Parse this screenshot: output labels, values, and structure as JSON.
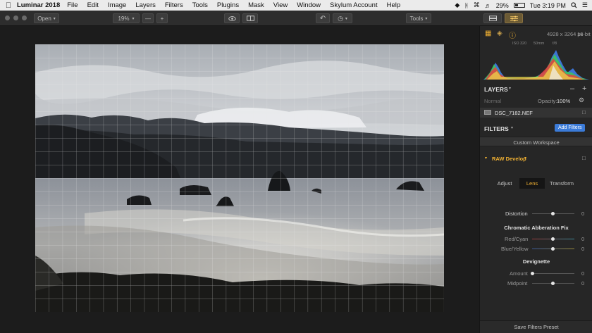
{
  "menubar": {
    "app_name": "Luminar 2018",
    "items": [
      "File",
      "Edit",
      "Image",
      "Layers",
      "Filters",
      "Tools",
      "Plugins",
      "Mask",
      "View",
      "Window",
      "Skylum Account",
      "Help"
    ],
    "battery": "29%",
    "clock": "Tue 3:19 PM"
  },
  "toolbar": {
    "open_label": "Open",
    "zoom_value": "19%",
    "zoom_minus": "—",
    "zoom_plus": "+",
    "tools_label": "Tools"
  },
  "panel": {
    "image_info": "4928 x 3264 px",
    "bit_depth": "16-bit",
    "histogram_labels": [
      "ISO 320",
      "50mm",
      "f/8"
    ],
    "layers_title": "LAYERS",
    "blend_mode": "Normal",
    "opacity_label": "Opacity:",
    "opacity_value": "100%",
    "layer_name": "DSC_7182.NEF",
    "filters_title": "FILTERS",
    "add_filters": "Add Filters",
    "workspace": "Custom Workspace",
    "raw_develop": "RAW Develop",
    "tabs": [
      "Adjust",
      "Lens",
      "Transform"
    ],
    "active_tab": "Lens",
    "distortion": {
      "label": "Distortion",
      "value": "0"
    },
    "chromatic_title": "Chromatic Abberation Fix",
    "red_cyan": {
      "label": "Red/Cyan",
      "value": "0"
    },
    "blue_yellow": {
      "label": "Blue/Yellow",
      "value": "0"
    },
    "devignette_title": "Devignette",
    "amount": {
      "label": "Amount",
      "value": "0"
    },
    "midpoint": {
      "label": "Midpoint",
      "value": "0"
    },
    "save_preset": "Save Filters Preset"
  },
  "colors": {
    "accent_orange": "#f2b233",
    "accent_blue": "#3b7bd8",
    "panel_bg": "#262626",
    "canvas_bg": "#1c1c1c"
  },
  "icons": [
    "apple-icon",
    "eye-icon",
    "compare-icon",
    "undo-icon",
    "history-icon",
    "histogram-icon",
    "layers-icon",
    "info-icon",
    "lock-icon",
    "gear-icon",
    "wifi-icon",
    "bluetooth-icon",
    "search-icon"
  ]
}
